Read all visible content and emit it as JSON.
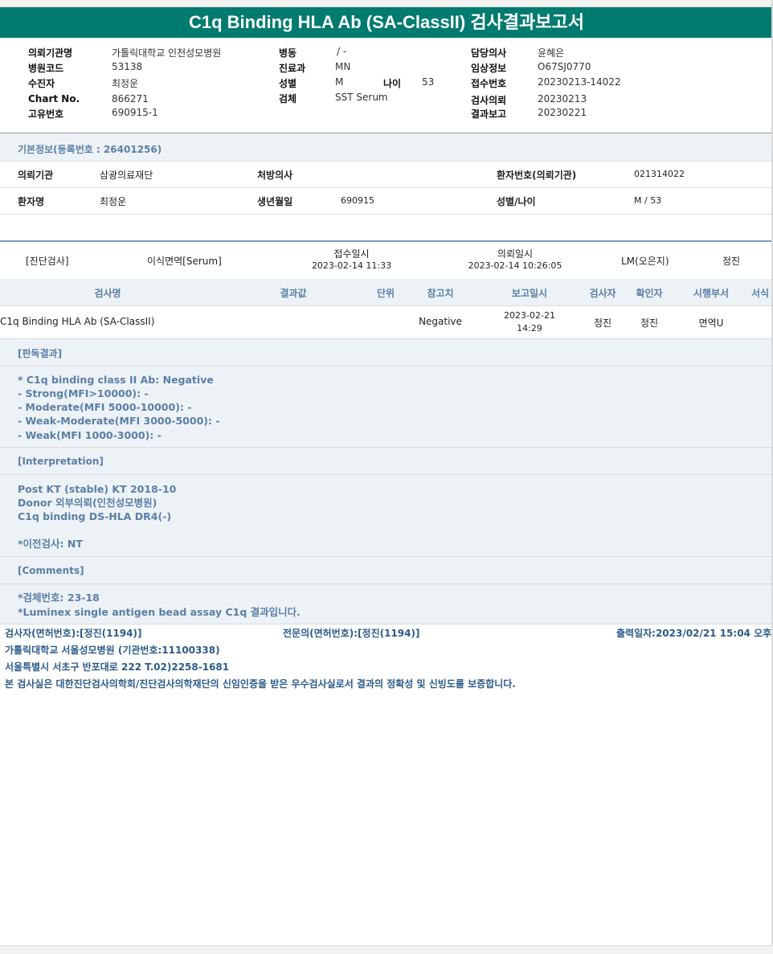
{
  "title": "C1q Binding HLA Ab (SA-ClassII) 검사결과보고서",
  "header": {
    "col1": [
      {
        "label": "의뢰기관명",
        "value": "가톨릭대학교 인천성모병원"
      },
      {
        "label": "병원코드",
        "value": "53138"
      },
      {
        "label": "수진자",
        "value": "최정운"
      },
      {
        "label": "Chart No.",
        "value": "866271"
      },
      {
        "label": "고유번호",
        "value": "690915-1"
      }
    ],
    "col2": [
      {
        "label": "병동",
        "value": "/ -"
      },
      {
        "label": "진료과",
        "value": "MN"
      },
      {
        "label": "성별",
        "value": "M"
      },
      {
        "label": "검체",
        "value": "SST Serum"
      }
    ],
    "age": {
      "label": "나이",
      "value": "53"
    },
    "col3": [
      {
        "label": "담당의사",
        "value": "윤혜은"
      },
      {
        "label": "임상정보",
        "value": "O67SJ0770"
      },
      {
        "label": "접수번호",
        "value": "20230213-14022"
      },
      {
        "label": "검사의뢰",
        "value": "20230213"
      },
      {
        "label": "결과보고",
        "value": "20230221"
      }
    ]
  },
  "basic_info": {
    "title": "기본정보(등록번호 : 26401256)",
    "row1": {
      "org_label": "의뢰기관",
      "org_value": "삼광의료재단",
      "doctor_label": "처방의사",
      "doctor_value": "",
      "patno_label": "환자번호(의뢰기관)",
      "patno_value": "021314022"
    },
    "row2": {
      "name_label": "환자명",
      "name_value": "최정운",
      "birth_label": "생년월일",
      "birth_value": "690915",
      "sexage_label": "성별/나이",
      "sexage_value": "M / 53"
    }
  },
  "order": {
    "category": "[진단검사]",
    "specimen": "이식면역[Serum]",
    "received_label": "접수일시",
    "received_value": "2023-02-14 11:33",
    "requested_label": "의뢰일시",
    "requested_value": "2023-02-14 10:26:05",
    "lm": "LM(오은지)",
    "person": "정진"
  },
  "results_table": {
    "headers": [
      "검사명",
      "결과값",
      "단위",
      "참고치",
      "보고일시",
      "검사자",
      "확인자",
      "시행부서",
      "서식"
    ],
    "row": {
      "test_name": "C1q Binding HLA Ab (SA-ClassII)",
      "result": "",
      "unit": "",
      "reference": "Negative",
      "report_date": "2023-02-21",
      "report_time": "14:29",
      "tester": "정진",
      "checker": "정진",
      "dept": "면역U"
    }
  },
  "interpretation_result": {
    "title": "[판독결과]",
    "lines": [
      "* C1q binding class II Ab: Negative",
      "- Strong(MFI>10000): -",
      "- Moderate(MFI 5000-10000): -",
      "- Weak-Moderate(MFI 3000-5000): -",
      "- Weak(MFI 1000-3000): -"
    ]
  },
  "interpretation": {
    "title": "[Interpretation]",
    "lines": [
      "Post KT (stable) KT 2018-10",
      "Donor 외부의뢰(인천성모병원)",
      "C1q binding DS-HLA DR4(-)"
    ],
    "prev": "*이전검사: NT"
  },
  "comments": {
    "title": "[Comments]",
    "lines": [
      "*검체번호: 23-18",
      "*Luminex single antigen bead assay C1q 결과입니다."
    ]
  },
  "footer": {
    "tester": "검사자(면허번호):[정진(1194)]",
    "specialist": "전문의(면허번호):[정진(1194)]",
    "printed": "출력일자:2023/02/21 15:04 오후",
    "hospital": "가톨릭대학교 서울성모병원 (기관번호:11100338)",
    "address": "서울특별시 서초구 반포대로 222 T.02)2258-1681",
    "certification": "본 검사실은 대한진단검사의학회/진단검사의학재단의 신임인증을 받은 우수검사실로서 결과의 정확성 및 신빙도를 보증합니다."
  },
  "colors": {
    "title_bar": "#007b6f",
    "section_text": "#5a7fa6",
    "band": "#edf2f7",
    "footer_text": "#2d5b8a"
  }
}
